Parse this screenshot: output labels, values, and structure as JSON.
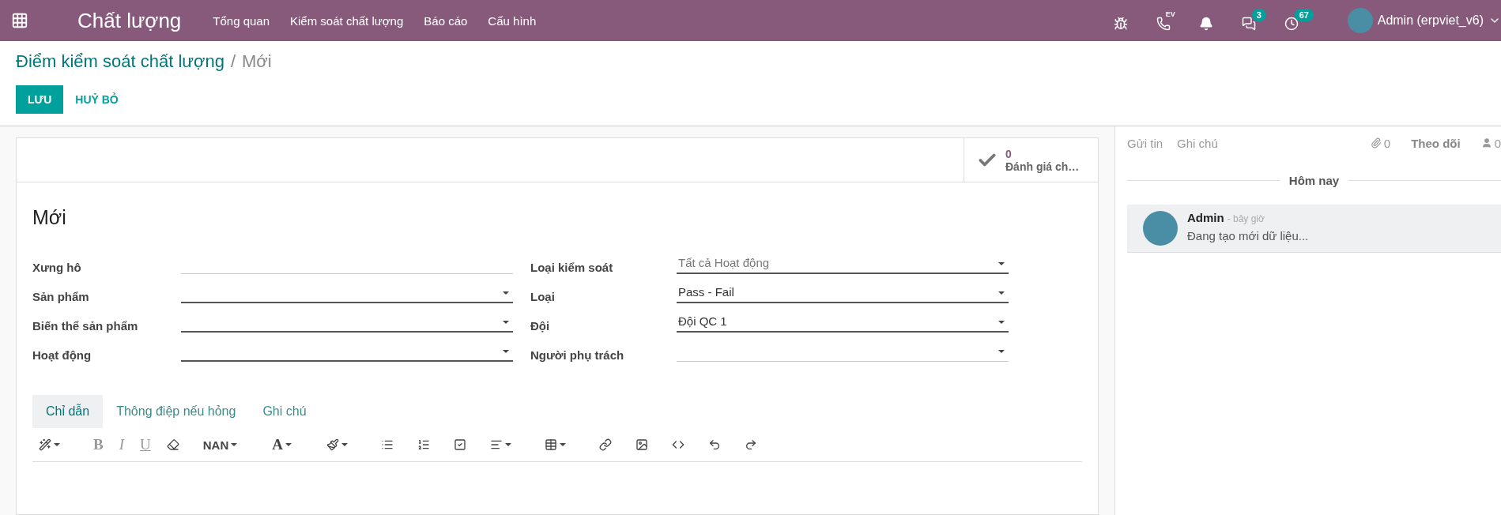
{
  "navbar": {
    "app_title": "Chất lượng",
    "menus": [
      "Tổng quan",
      "Kiểm soát chất lượng",
      "Báo cáo",
      "Cấu hình"
    ],
    "systray": [
      {
        "kind": "bug"
      },
      {
        "kind": "phone",
        "label": "EV"
      },
      {
        "kind": "bell"
      },
      {
        "kind": "chat",
        "badge": "3"
      },
      {
        "kind": "clock",
        "badge": "67"
      }
    ],
    "user": "Admin (erpviet_v6)"
  },
  "breadcrumb": {
    "parent": "Điểm kiểm soát chất lượng",
    "separator": "/",
    "current": "Mới"
  },
  "buttons": [
    {
      "label": "LƯU",
      "kind": "primary"
    },
    {
      "label": "HUỶ BỎ",
      "kind": "secondary"
    }
  ],
  "stat_button": {
    "value": "0",
    "label": "Đánh giá ch…"
  },
  "form": {
    "title": "Mới",
    "left_fields": [
      {
        "label": "Xưng hô",
        "dropdown": false,
        "required": false
      },
      {
        "label": "Sản phẩm",
        "dropdown": true,
        "required": true
      },
      {
        "label": "Biến thể sản phẩm",
        "dropdown": true,
        "required": true
      },
      {
        "label": "Hoạt động",
        "dropdown": true,
        "required": true
      }
    ],
    "right_fields": [
      {
        "label": "Loại kiểm soát",
        "placeholder": "Tất cả Hoạt động",
        "dropdown": true,
        "required": true
      },
      {
        "label": "Loại",
        "value": "Pass - Fail",
        "dropdown": true,
        "required": true
      },
      {
        "label": "Đội",
        "value": "Đội QC 1",
        "dropdown": true,
        "required": true
      },
      {
        "label": "Người phụ trách",
        "dropdown": true,
        "required": false
      }
    ],
    "tabs": [
      {
        "label": "Chỉ dẫn",
        "selected": true
      },
      {
        "label": "Thông điệp nếu hỏng",
        "selected": false
      },
      {
        "label": "Ghi chú",
        "selected": false
      }
    ],
    "toolbar": [
      {
        "kind": "wand",
        "caret": true
      },
      {
        "kind": "bold",
        "text": "B",
        "caret": false
      },
      {
        "kind": "italic",
        "text": "I",
        "caret": false
      },
      {
        "kind": "underline",
        "text": "U",
        "caret": false
      },
      {
        "kind": "eraser",
        "caret": false
      },
      {
        "kind": "font",
        "text": "NAN",
        "caret": true
      },
      {
        "kind": "color",
        "text": "A",
        "caret": true
      },
      {
        "kind": "brush",
        "caret": true
      },
      {
        "kind": "ul",
        "caret": false
      },
      {
        "kind": "ol",
        "caret": false
      },
      {
        "kind": "check",
        "caret": false
      },
      {
        "kind": "align",
        "caret": true
      },
      {
        "kind": "table",
        "caret": true
      },
      {
        "kind": "link",
        "caret": false
      },
      {
        "kind": "image",
        "caret": false
      },
      {
        "kind": "code",
        "caret": false
      },
      {
        "kind": "undo",
        "caret": false
      },
      {
        "kind": "redo",
        "caret": false
      }
    ]
  },
  "chatter": {
    "actions": [
      "Gửi tin",
      "Ghi chú"
    ],
    "attachments": "0",
    "follow": "Theo dõi",
    "followers": "0",
    "day": "Hôm nay",
    "messages": [
      {
        "author": "Admin",
        "time": "- bây giờ",
        "body": "Đang tạo mới dữ liệu..."
      }
    ]
  }
}
